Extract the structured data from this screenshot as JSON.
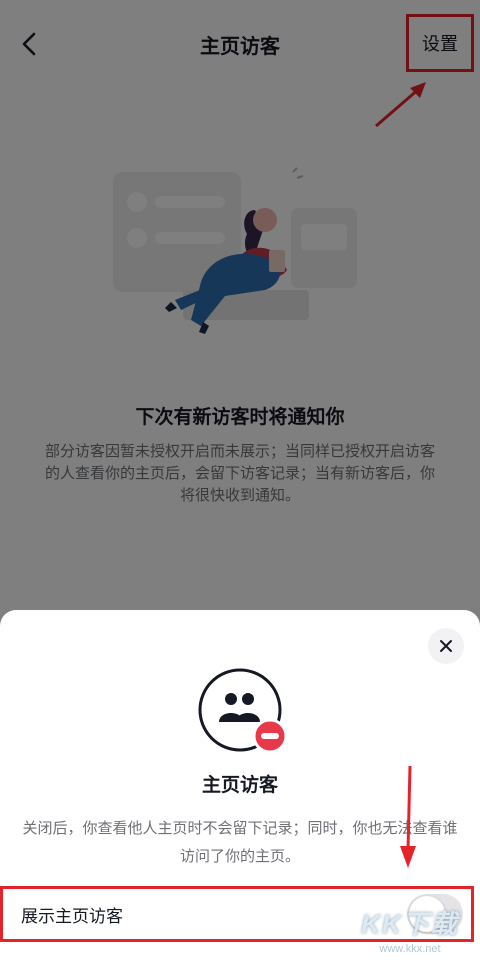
{
  "nav": {
    "title": "主页访客",
    "settings_label": "设置"
  },
  "empty_state": {
    "title": "下次有新访客时将通知你",
    "description": "部分访客因暂未授权开启而未展示；当同样已授权开启访客的人查看你的主页后，会留下访客记录；当有新访客后，你将很快收到通知。"
  },
  "sheet": {
    "title": "主页访客",
    "description": "关闭后，你查看他人主页时不会留下记录；同时，你也无法查看谁访问了你的主页。",
    "toggle_label": "展示主页访客",
    "toggle_on": false
  },
  "watermark": {
    "logo": "KK下载",
    "url": "www.kkx.net"
  },
  "colors": {
    "annotation_red": "#e5232b",
    "remove_badge": "#e8394a",
    "text_primary": "#161823",
    "text_secondary": "#6f7075"
  },
  "icons": {
    "back": "chevron-left-icon",
    "close": "close-icon",
    "visitors": "users-icon",
    "remove_badge": "minus-circle-icon"
  }
}
